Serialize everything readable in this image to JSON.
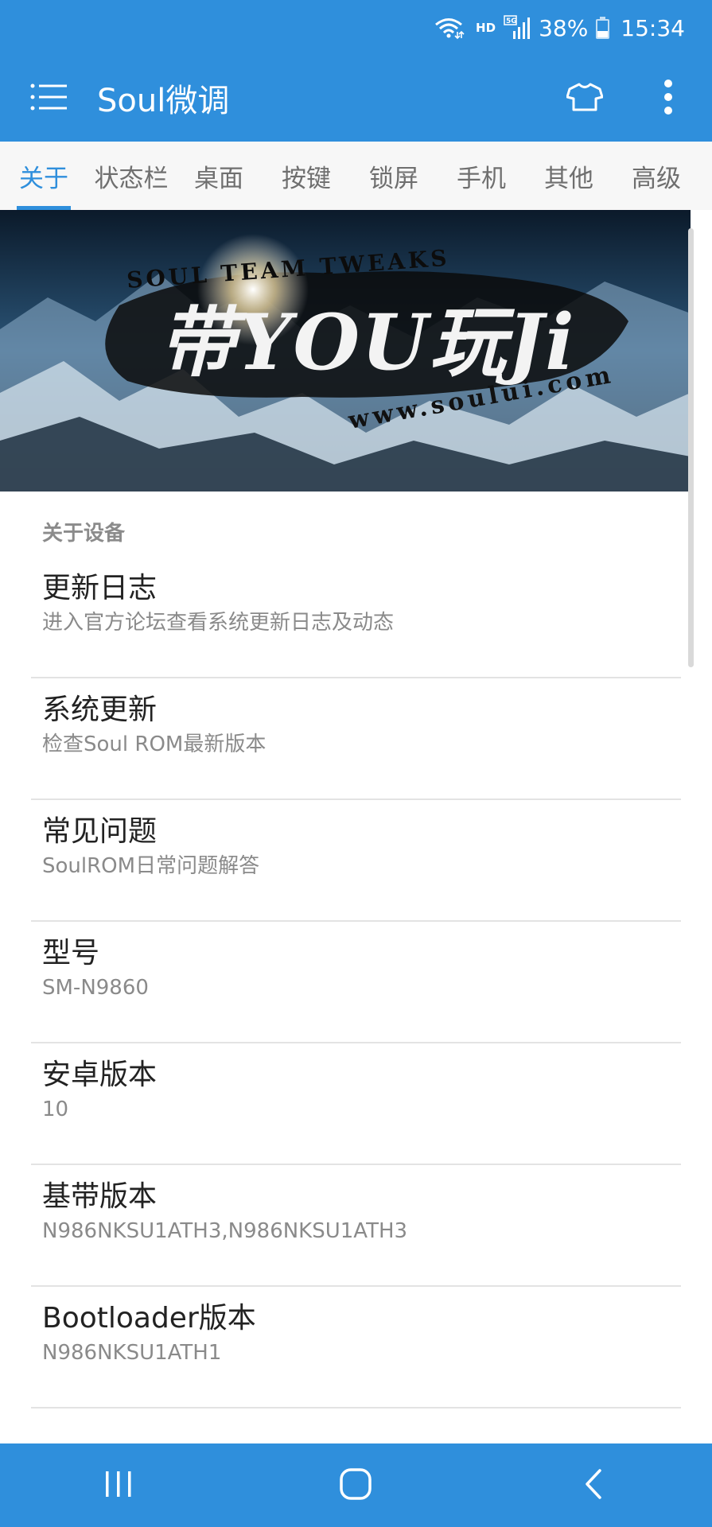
{
  "status_bar": {
    "hd_label": "HD",
    "network_label": "5G",
    "battery_percent": "38%",
    "battery_level": 0.38,
    "time": "15:34",
    "icons": [
      "wifi-icon",
      "signal-icon",
      "battery-icon"
    ]
  },
  "app_bar": {
    "title": "Soul微调",
    "icons": [
      "menu-icon",
      "tshirt-icon",
      "more-vert-icon"
    ]
  },
  "tabs": [
    {
      "label": "关于",
      "active": true
    },
    {
      "label": "状态栏",
      "active": false
    },
    {
      "label": "桌面",
      "active": false
    },
    {
      "label": "按键",
      "active": false
    },
    {
      "label": "锁屏",
      "active": false
    },
    {
      "label": "手机",
      "active": false
    },
    {
      "label": "其他",
      "active": false
    },
    {
      "label": "高级",
      "active": false
    }
  ],
  "banner": {
    "line1": "SOUL TEAM TWEAKS",
    "line2": "带YOU玩Ji",
    "line3": "www.soului.com"
  },
  "section": {
    "header": "关于设备",
    "items": [
      {
        "title": "更新日志",
        "subtitle": "进入官方论坛查看系统更新日志及动态"
      },
      {
        "title": "系统更新",
        "subtitle": "检查Soul ROM最新版本"
      },
      {
        "title": "常见问题",
        "subtitle": "SoulROM日常问题解答"
      },
      {
        "title": "型号",
        "subtitle": "SM-N9860"
      },
      {
        "title": "安卓版本",
        "subtitle": "10"
      },
      {
        "title": "基带版本",
        "subtitle": "N986NKSU1ATH3,N986NKSU1ATH3"
      },
      {
        "title": "Bootloader版本",
        "subtitle": "N986NKSU1ATH1"
      }
    ]
  },
  "nav_bar": {
    "icons": [
      "recents-icon",
      "home-icon",
      "back-icon"
    ]
  },
  "colors": {
    "primary": "#2f8fdc",
    "tab_inactive": "#6f6f6f",
    "title_text": "#222222",
    "subtitle_text": "#8a8a8a",
    "section_header": "#8b8b8b"
  }
}
